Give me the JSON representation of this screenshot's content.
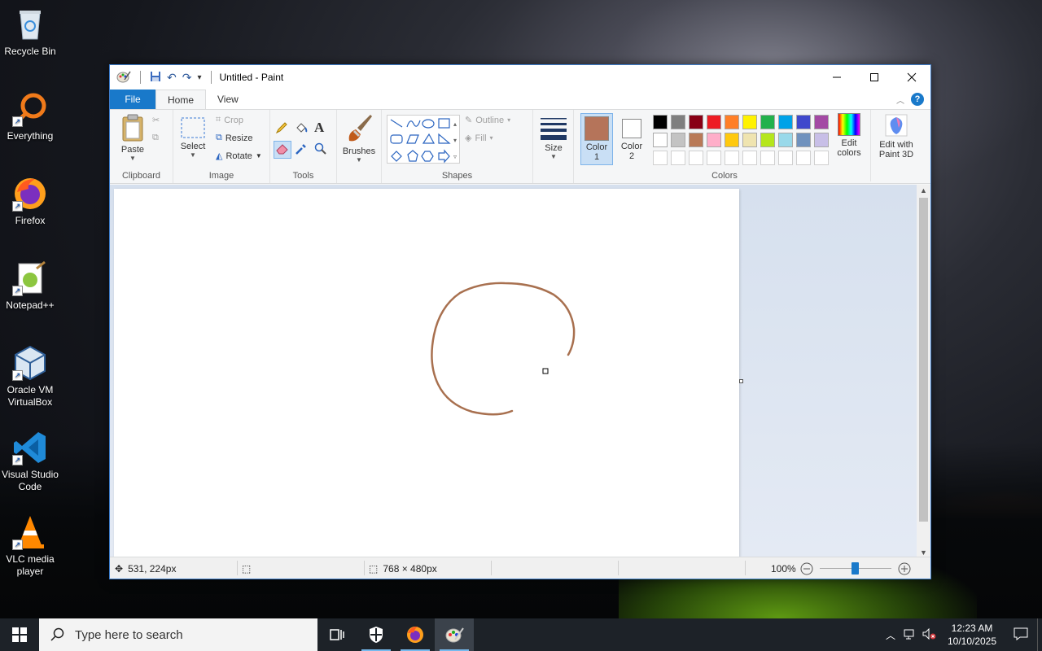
{
  "desktop": {
    "icons": [
      {
        "label": "Recycle Bin",
        "icon": "recycle-bin-icon"
      },
      {
        "label": "Everything",
        "icon": "everything-search-icon"
      },
      {
        "label": "Firefox",
        "icon": "firefox-icon"
      },
      {
        "label": "Notepad++",
        "icon": "notepadpp-icon"
      },
      {
        "label": "Oracle VM VirtualBox",
        "icon": "virtualbox-icon"
      },
      {
        "label": "Visual Studio Code",
        "icon": "vscode-icon"
      },
      {
        "label": "VLC media player",
        "icon": "vlc-icon"
      }
    ]
  },
  "window": {
    "title": "Untitled - Paint",
    "tabs": {
      "file": "File",
      "home": "Home",
      "view": "View"
    },
    "ribbon": {
      "clipboard": {
        "paste": "Paste",
        "label": "Clipboard"
      },
      "image": {
        "select": "Select",
        "crop": "Crop",
        "resize": "Resize",
        "rotate": "Rotate",
        "label": "Image"
      },
      "tools": {
        "label": "Tools"
      },
      "brushes": {
        "label": "Brushes"
      },
      "shapes": {
        "outline": "Outline",
        "fill": "Fill",
        "label": "Shapes"
      },
      "size": {
        "label": "Size"
      },
      "colors": {
        "color1_line1": "Color",
        "color1_line2": "1",
        "color2_line1": "Color",
        "color2_line2": "2",
        "edit_line1": "Edit",
        "edit_line2": "colors",
        "paint3d_line1": "Edit with",
        "paint3d_line2": "Paint 3D",
        "label": "Colors",
        "color1": "#b5745a",
        "color2": "#ffffff",
        "palette_row1": [
          "#000000",
          "#7f7f7f",
          "#880015",
          "#ed1c24",
          "#ff7f27",
          "#fff200",
          "#22b14c",
          "#00a2e8",
          "#3f48cc",
          "#a349a4"
        ],
        "palette_row2": [
          "#ffffff",
          "#c3c3c3",
          "#b97a57",
          "#ffaec9",
          "#ffc90e",
          "#efe4b0",
          "#b5e61d",
          "#99d9ea",
          "#7092be",
          "#c8bfe7"
        ],
        "palette_row3": [
          "#ffffff",
          "#ffffff",
          "#ffffff",
          "#ffffff",
          "#ffffff",
          "#ffffff",
          "#ffffff",
          "#ffffff",
          "#ffffff",
          "#ffffff"
        ]
      }
    },
    "status": {
      "cursor_pos": "531, 224px",
      "canvas_size": "768 × 480px",
      "zoom": "100%"
    },
    "stroke_color": "#a8704f"
  },
  "taskbar": {
    "search_placeholder": "Type here to search",
    "time": "12:23 AM",
    "date": "10/10/2025"
  }
}
